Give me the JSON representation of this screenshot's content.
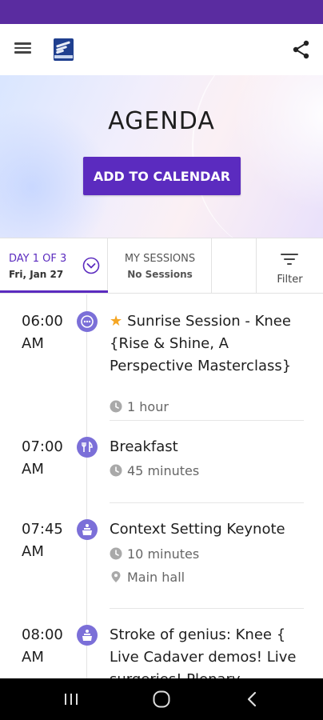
{
  "colors": {
    "status_bar": "#5a2ca0",
    "accent": "#5b2bbf",
    "session_icon": "#7b6fd8",
    "star": "#f5a623"
  },
  "header": {
    "menu_icon": "hamburger-menu-icon",
    "logo": "isakos-logo",
    "share_icon": "share-icon"
  },
  "hero": {
    "title": "AGENDA",
    "add_to_calendar": "ADD TO CALENDAR"
  },
  "tabs": {
    "day": {
      "label": "DAY 1 OF 3",
      "date": "Fri, Jan 27",
      "icon": "chevron-down-circle-icon"
    },
    "my_sessions": {
      "label": "MY SESSIONS",
      "sub": "No Sessions"
    },
    "filter": {
      "label": "Filter",
      "icon": "filter-icon"
    }
  },
  "sessions": [
    {
      "time": "06:00 AM",
      "icon": "more-circle-icon",
      "starred": true,
      "star_glyph": "★",
      "title": "Sunrise Session - Knee {Rise & Shine, A Perspective Masterclass}",
      "duration": "1 hour",
      "location": ""
    },
    {
      "time": "07:00 AM",
      "icon": "dining-icon",
      "starred": false,
      "title": "Breakfast",
      "duration": "45 minutes",
      "location": ""
    },
    {
      "time": "07:45 AM",
      "icon": "podium-icon",
      "starred": false,
      "title": "Context Setting Keynote",
      "duration": "10 minutes",
      "location": "Main hall"
    },
    {
      "time": "08:00 AM",
      "icon": "podium-icon",
      "starred": false,
      "title": "Stroke of genius: Knee { Live Cadaver demos! Live surgeries! Plenary",
      "duration": "",
      "location": ""
    }
  ],
  "nav": {
    "recent": "recent-apps-icon",
    "home": "home-icon",
    "back": "back-icon"
  }
}
